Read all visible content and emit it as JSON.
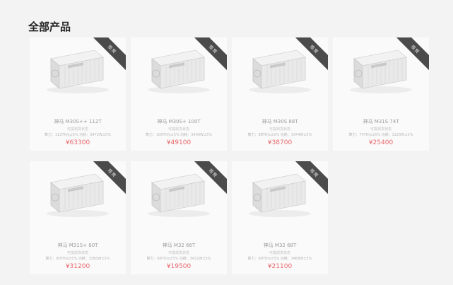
{
  "page": {
    "title": "全部产品"
  },
  "colors": {
    "price": "#e9676b",
    "ribbon": "#4b4b4b",
    "card": "#fafafa",
    "background": "#f3f3f4"
  },
  "products": [
    {
      "badge": "现货",
      "name": "神马 M30S++ 112T",
      "subtitle": "可提现货状态",
      "spec": "算力：112TH/s±5% 功耗：3472W±5%",
      "price": "¥63300",
      "image_icon": "miner-image"
    },
    {
      "badge": "现货",
      "name": "神马 M30S+ 100T",
      "subtitle": "可提现货状态",
      "spec": "算力：100TH/s±5% 功耗：3400W±5%",
      "price": "¥49100",
      "image_icon": "miner-image"
    },
    {
      "badge": "现货",
      "name": "神马 M30S 88T",
      "subtitle": "可提现货状态",
      "spec": "算力：88TH/s±5% 功耗：3344W±5%",
      "price": "¥38700",
      "image_icon": "miner-image"
    },
    {
      "badge": "现货",
      "name": "神马 M31S 74T",
      "subtitle": "可提现货状态",
      "spec": "算力：74TH/s±5% 功耗：3220W±5%",
      "price": "¥25400",
      "image_icon": "miner-image"
    },
    {
      "badge": "现货",
      "name": "神马 M31S+ 80T",
      "subtitle": "可提现货状态",
      "spec": "算力：80TH/s±5% 功耗：3360W±5%",
      "price": "¥31200",
      "image_icon": "miner-image"
    },
    {
      "badge": "现货",
      "name": "神马 M32 66T",
      "subtitle": "可提现货状态",
      "spec": "算力：66TH/s±5% 功耗：3432W±5%",
      "price": "¥19500",
      "image_icon": "miner-image"
    },
    {
      "badge": "现货",
      "name": "神马 M32 68T",
      "subtitle": "可提现货状态",
      "spec": "算力：68TH/s±5% 功耗：3468W±5%",
      "price": "¥21100",
      "image_icon": "miner-image"
    }
  ]
}
